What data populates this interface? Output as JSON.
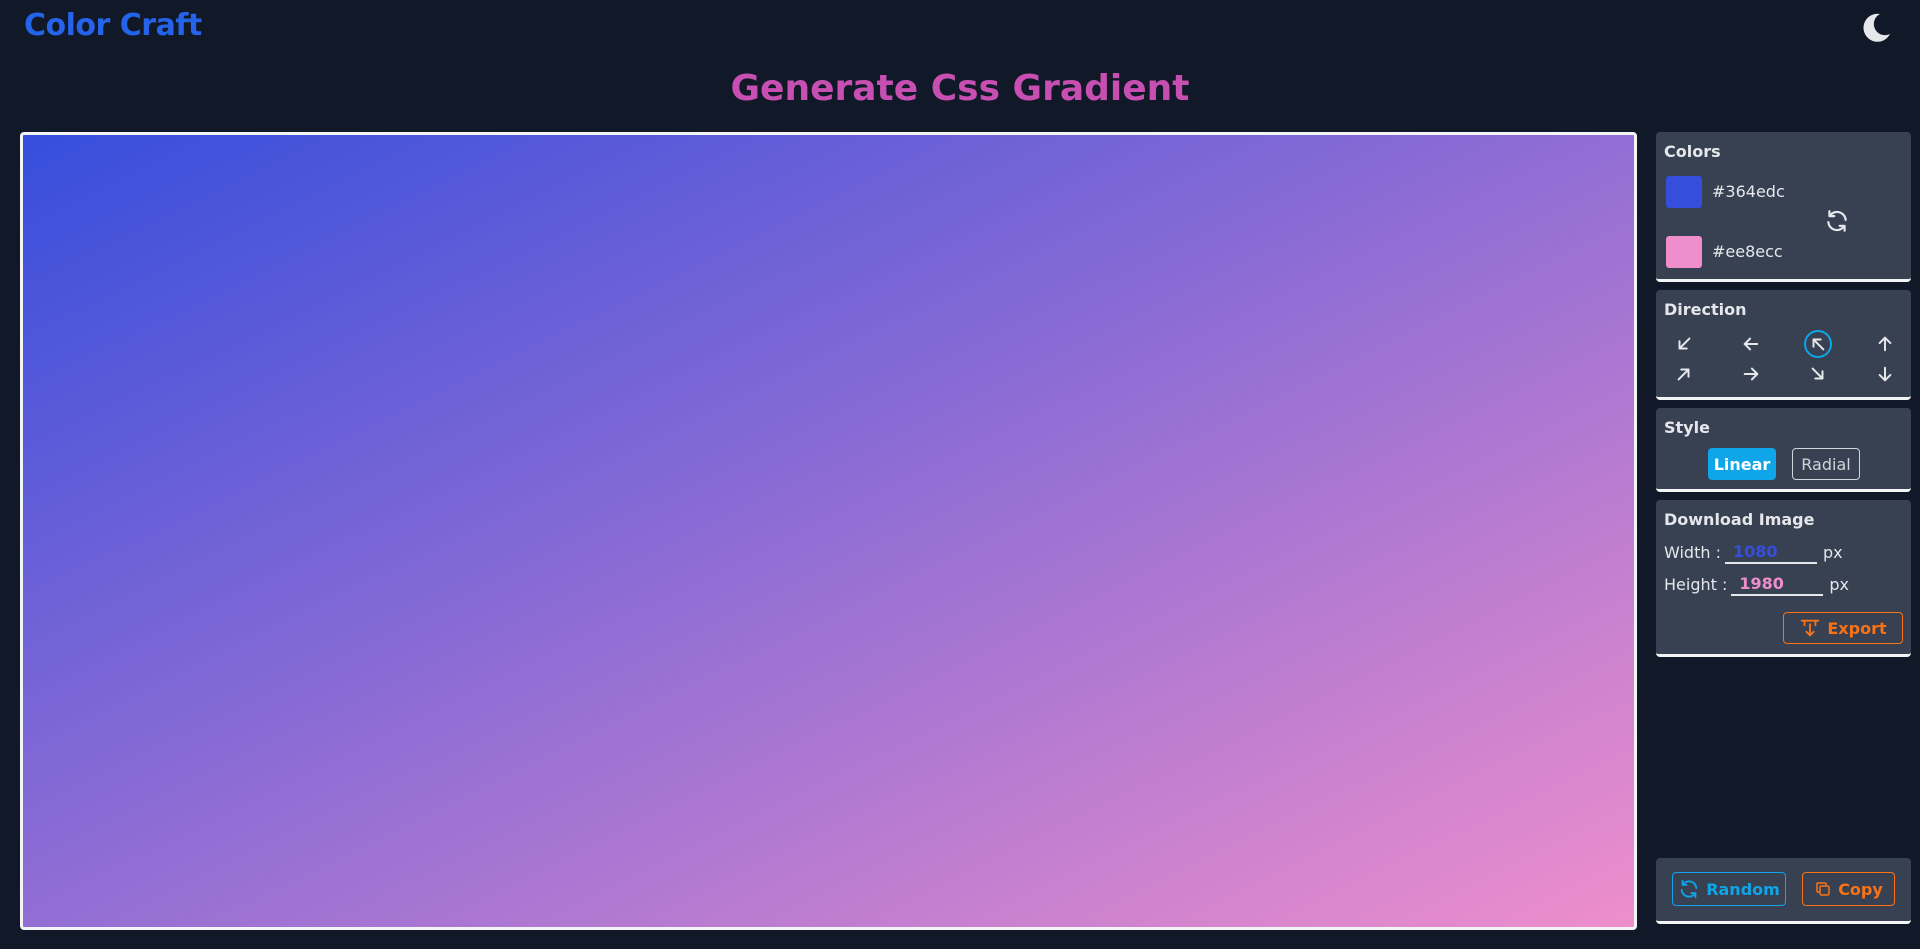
{
  "app": {
    "logo_text": "Color Craft",
    "page_title": "Generate Css Gradient"
  },
  "theme_toggle": {
    "icon": "moon-icon"
  },
  "gradient": {
    "color1": "#364edc",
    "color2": "#ee8ecc",
    "direction": "to bottom right",
    "style": "Linear"
  },
  "colors_panel": {
    "title": "Colors",
    "color1_hex": "#364edc",
    "color2_hex": "#ee8ecc",
    "swap_icon": "refresh-icon"
  },
  "direction_panel": {
    "title": "Direction",
    "directions": [
      {
        "name": "down-left",
        "icon": "arrow-down-left-icon",
        "active": false
      },
      {
        "name": "left",
        "icon": "arrow-left-icon",
        "active": false
      },
      {
        "name": "up-left",
        "icon": "arrow-up-left-icon",
        "active": true
      },
      {
        "name": "up",
        "icon": "arrow-up-icon",
        "active": false
      },
      {
        "name": "up-right",
        "icon": "arrow-up-right-icon",
        "active": false
      },
      {
        "name": "right",
        "icon": "arrow-right-icon",
        "active": false
      },
      {
        "name": "down-right",
        "icon": "arrow-down-right-icon",
        "active": false
      },
      {
        "name": "down",
        "icon": "arrow-down-icon",
        "active": false
      }
    ]
  },
  "style_panel": {
    "title": "Style",
    "linear_label": "Linear",
    "radial_label": "Radial",
    "selected": "Linear"
  },
  "download_panel": {
    "title": "Download Image",
    "width_label": "Width :",
    "width_value": "1080",
    "height_label": "Height :",
    "height_value": "1980",
    "unit": "px",
    "export_label": "Export"
  },
  "actions": {
    "random_label": "Random",
    "copy_label": "Copy"
  },
  "palette": {
    "background": "#111827",
    "panel": "#374151",
    "accent_blue": "#0ea5e9",
    "accent_orange": "#f97316",
    "logo_blue": "#2563eb",
    "title_pink": "#c84fb2"
  }
}
